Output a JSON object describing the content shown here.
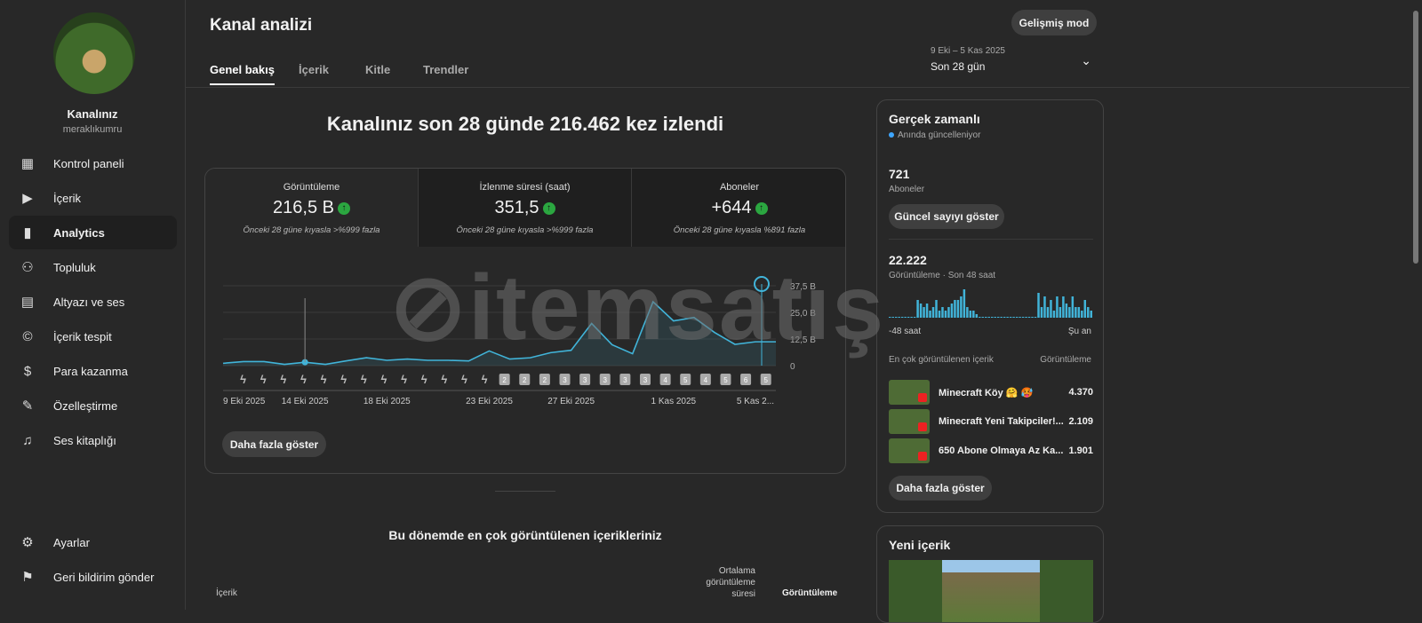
{
  "sidebar": {
    "channel_name": "Kanalınız",
    "handle": "meraklıkumru",
    "items": [
      {
        "label": "Kontrol paneli",
        "icon": "dashboard-icon"
      },
      {
        "label": "İçerik",
        "icon": "content-icon"
      },
      {
        "label": "Analytics",
        "icon": "analytics-icon"
      },
      {
        "label": "Topluluk",
        "icon": "community-icon"
      },
      {
        "label": "Altyazı ve ses",
        "icon": "subtitles-icon"
      },
      {
        "label": "İçerik tespit",
        "icon": "copyright-icon"
      },
      {
        "label": "Para kazanma",
        "icon": "dollar-icon"
      },
      {
        "label": "Özelleştirme",
        "icon": "wand-icon"
      },
      {
        "label": "Ses kitaplığı",
        "icon": "audio-library-icon"
      }
    ],
    "settings": "Ayarlar",
    "feedback": "Geri bildirim gönder"
  },
  "header": {
    "title": "Kanal analizi",
    "advanced": "Gelişmiş mod",
    "tabs": [
      "Genel bakış",
      "İçerik",
      "Kitle",
      "Trendler"
    ],
    "date_range": "9 Eki – 5 Kas 2025",
    "period": "Son 28 gün"
  },
  "main": {
    "headline": "Kanalınız son 28 günde 216.462 kez izlendi",
    "metrics": [
      {
        "label": "Görüntüleme",
        "value": "216,5 B",
        "sub": "Önceki 28 güne kıyasla >%999 fazla"
      },
      {
        "label": "İzlenme süresi (saat)",
        "value": "351,5",
        "sub": "Önceki 28 güne kıyasla >%999 fazla"
      },
      {
        "label": "Aboneler",
        "value": "+644",
        "sub": "Önceki 28 güne kıyasla %891 fazla"
      }
    ],
    "more": "Daha fazla göster",
    "top_title": "Bu dönemde en çok görüntülenen içerikleriniz",
    "col_content": "İçerik",
    "col_avg": "Ortalama görüntüleme süresi",
    "col_views": "Görüntüleme"
  },
  "chart_data": {
    "type": "area",
    "ylabel": "Görüntüleme",
    "y_ticks": [
      "0",
      "12,5 B",
      "25,0 B",
      "37,5 B"
    ],
    "ylim": [
      0,
      37.5
    ],
    "x_tick_labels": [
      "9 Eki 2025",
      "14 Eki 2025",
      "18 Eki 2025",
      "23 Eki 2025",
      "27 Eki 2025",
      "1 Kas 2025",
      "5 Kas 2..."
    ],
    "x_tick_index": [
      0,
      4,
      8,
      13,
      17,
      22,
      26
    ],
    "values_thousands": [
      1.1,
      1.9,
      1.9,
      0.6,
      1.6,
      0.6,
      2.2,
      3.7,
      2.5,
      3.1,
      2.5,
      2.5,
      2.2,
      6.9,
      3.1,
      3.7,
      6.1,
      7.2,
      19.8,
      9.8,
      5.6,
      30,
      21,
      22.6,
      15.6,
      10,
      11.2,
      11.2
    ],
    "badges": [
      "s",
      "s",
      "s",
      "s",
      "s",
      "s",
      "s",
      "s",
      "s",
      "s",
      "s",
      "s",
      "s",
      "2",
      "2",
      "2",
      "3",
      "3",
      "3",
      "3",
      "3",
      "4",
      "5",
      "4",
      "5",
      "6",
      "5"
    ]
  },
  "realtime": {
    "title": "Gerçek zamanlı",
    "live": "Anında güncelleniyor",
    "subs": "721",
    "subs_label": "Aboneler",
    "show_count": "Güncel sayıyı göster",
    "views": "22.222",
    "views_label": "Görüntüleme · Son 48 saat",
    "left": "-48 saat",
    "right": "Şu an",
    "top_label": "En çok görüntülenen içerik",
    "views_col": "Görüntüleme",
    "bars": [
      0,
      0,
      0,
      0,
      0,
      0,
      0,
      0,
      0,
      5,
      4,
      3,
      4,
      2,
      3,
      5,
      2,
      3,
      2,
      3,
      4,
      5,
      5,
      6,
      8,
      3,
      2,
      2,
      1,
      0,
      0,
      0,
      0,
      0,
      0,
      0,
      0,
      0,
      0,
      0,
      0,
      0,
      0,
      0,
      0,
      0,
      0,
      0,
      7,
      3,
      6,
      3,
      5,
      2,
      6,
      3,
      6,
      4,
      3,
      6,
      3,
      3,
      2,
      5,
      3,
      2
    ],
    "items": [
      {
        "title": "Minecraft Köy 🤗 🥵",
        "views": "4.370"
      },
      {
        "title": "Minecraft Yeni Takipciler!...",
        "views": "2.109"
      },
      {
        "title": "650 Abone Olmaya Az Ka...",
        "views": "1.901"
      }
    ],
    "more": "Daha fazla göster",
    "new_content": "Yeni içerik"
  },
  "watermark": "itemsatış",
  "colors": {
    "accent": "#3ea6ff",
    "line": "#41b4d9",
    "up": "#2ba640"
  }
}
